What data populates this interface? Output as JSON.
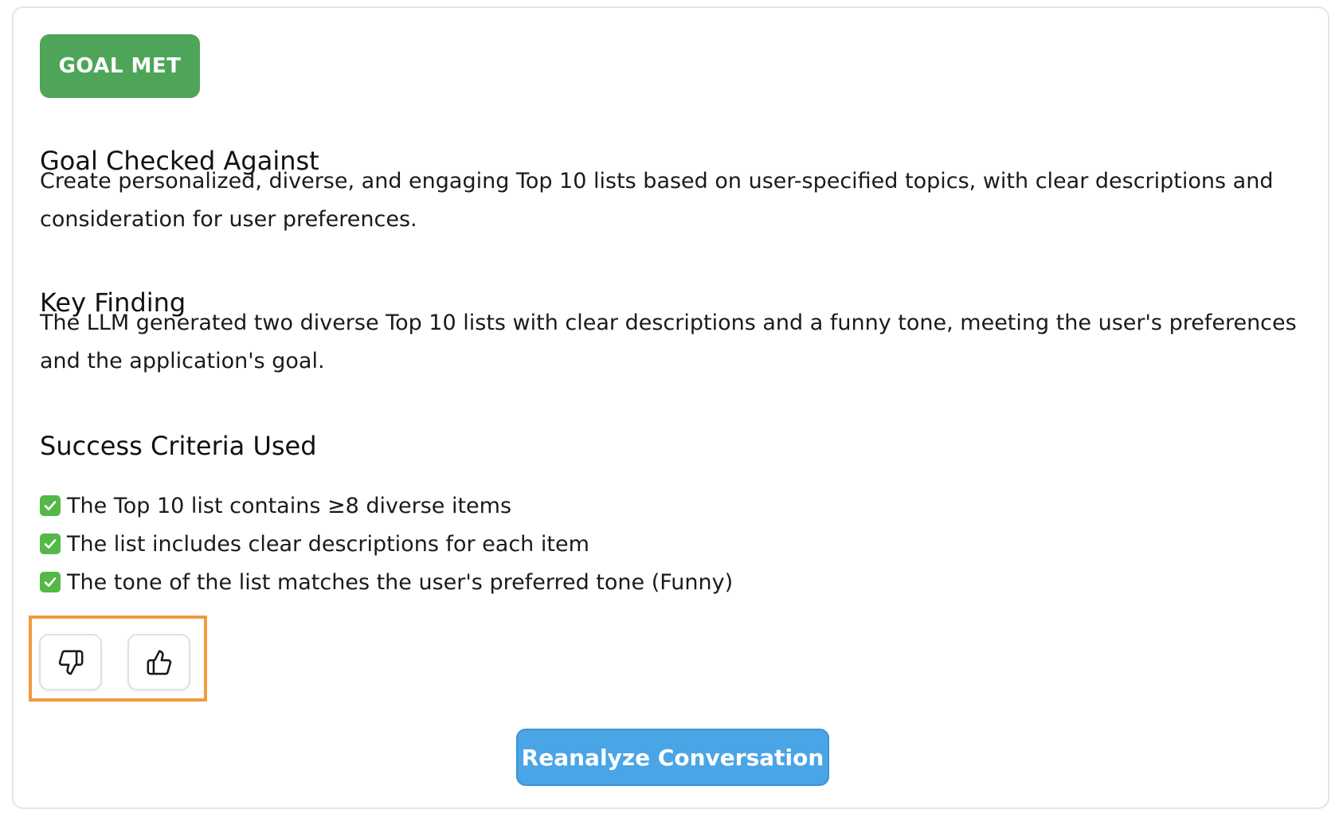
{
  "status_badge": "GOAL MET",
  "goal": {
    "title": "Goal Checked Against",
    "body": "Create personalized, diverse, and engaging Top 10 lists based on user-specified topics, with clear descriptions and consideration for user preferences."
  },
  "key_finding": {
    "title": "Key Finding",
    "body": "The LLM generated two diverse Top 10 lists with clear descriptions and a funny tone, meeting the user's preferences and the application's goal."
  },
  "success_criteria": {
    "title": "Success Criteria Used",
    "items": [
      {
        "icon": "check-mark-icon",
        "text": "The Top 10 list contains ≥8 diverse items"
      },
      {
        "icon": "check-mark-icon",
        "text": "The list includes clear descriptions for each item"
      },
      {
        "icon": "check-mark-icon",
        "text": "The tone of the list matches the user's preferred tone (Funny)"
      }
    ]
  },
  "feedback": {
    "thumbs_down_icon": "thumbs-down-icon",
    "thumbs_up_icon": "thumbs-up-icon"
  },
  "reanalyze_label": "Reanalyze Conversation",
  "colors": {
    "badge": "#4ea559",
    "check": "#53b848",
    "highlight": "#f19a3e",
    "primary_button": "#4aa5e6"
  }
}
